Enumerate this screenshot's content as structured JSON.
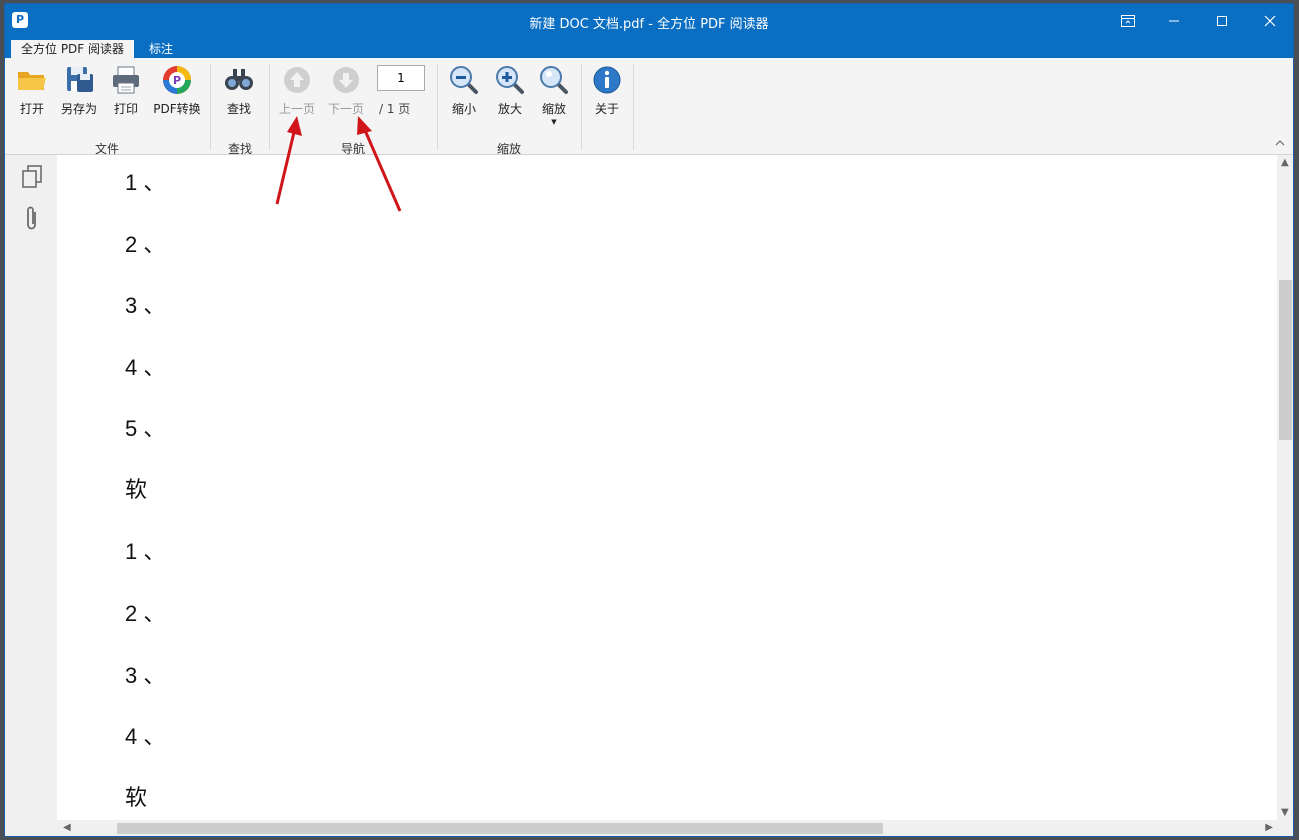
{
  "window": {
    "title": "新建 DOC 文档.pdf - 全方位 PDF 阅读器",
    "logo_letter": "P"
  },
  "tabs": [
    {
      "label": "全方位 PDF 阅读器",
      "active": true
    },
    {
      "label": "标注",
      "active": false
    }
  ],
  "ribbon": {
    "file": {
      "group_label": "文件",
      "open": "打开",
      "save_as": "另存为",
      "print": "打印",
      "pdf_convert": "PDF转换"
    },
    "find": {
      "group_label": "查找",
      "find": "查找"
    },
    "navigation": {
      "group_label": "导航",
      "prev_page": "上一页",
      "next_page": "下一页",
      "page_value": "1",
      "page_total": "/ 1 页"
    },
    "zoom": {
      "group_label": "缩放",
      "zoom_out": "缩小",
      "zoom_in": "放大",
      "zoom": "缩放"
    },
    "about": {
      "about": "关于"
    }
  },
  "document": {
    "lines": [
      "1 、",
      "2 、",
      "3 、",
      "4 、",
      "5 、",
      "软",
      "1 、",
      "2 、",
      "3 、",
      "4 、",
      "软"
    ]
  },
  "colors": {
    "titlebar": "#0a6fc2",
    "annotation_arrow": "#d0161b"
  }
}
